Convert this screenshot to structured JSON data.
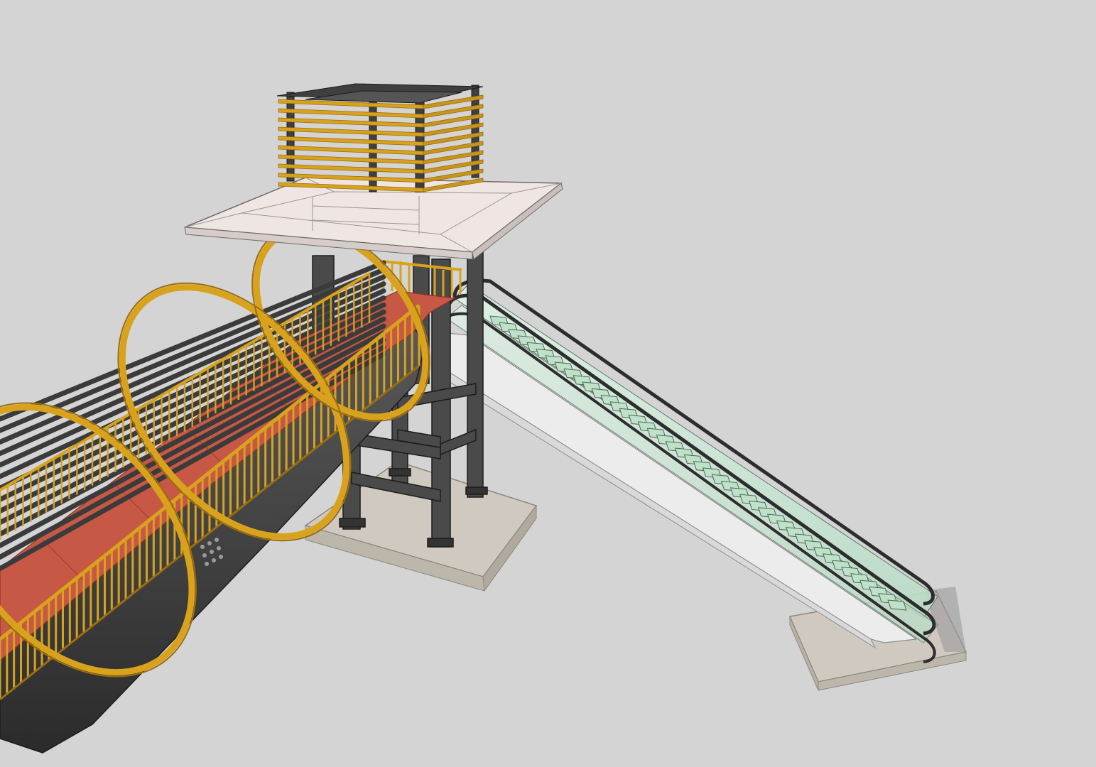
{
  "scene": {
    "background": "#d4d4d4",
    "colors": {
      "steel": "#4a4a4a",
      "steel_dark": "#333333",
      "steel_edge": "#1c1c1c",
      "rail_yellow": "#d9a21c",
      "rail_yellow_dark": "#9a6e10",
      "deck_red": "#c65845",
      "deck_red_dark": "#a8442f",
      "roof": "#efe6e4",
      "roof_edge": "#6f6a68",
      "concrete": "#cfc9c0",
      "concrete_side": "#b8b1a6",
      "glass": "#c9e6d4",
      "escalator_body": "#ececec"
    }
  }
}
